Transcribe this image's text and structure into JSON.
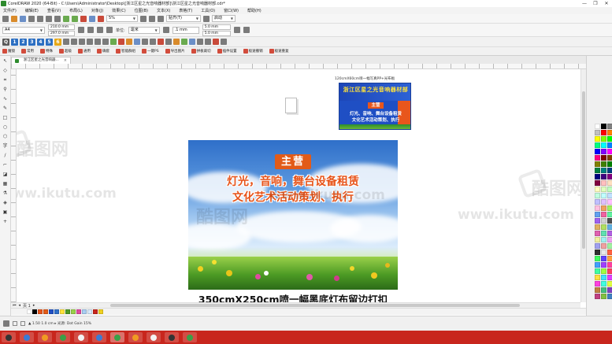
{
  "window": {
    "title": "CorelDRAW 2020 (64-Bit) - C:\\Users\\Administrator\\Desktop\\[浙江区星之光音响器材部]\\浙江区星之光音响器材部.cdr*",
    "controls": [
      "—",
      "❐",
      "✕"
    ]
  },
  "menu": {
    "items": [
      "文件(F)",
      "编辑(E)",
      "查看(V)",
      "布局(L)",
      "对象(J)",
      "效果(C)",
      "位图(B)",
      "文本(X)",
      "表格(T)",
      "工具(O)",
      "窗口(W)",
      "帮助(H)"
    ]
  },
  "toolbar": {
    "zoom": "5%",
    "snap": "贴齐(T)",
    "launch": "启动"
  },
  "propbar": {
    "paper": "A4",
    "width": "210.0 mm",
    "height": "297.0 mm",
    "unit_label": "单位:",
    "unit": "毫米",
    "nudge": ".1 mm",
    "dup_x": "5.0 mm",
    "dup_y": "5.0 mm"
  },
  "plugins_row1": {
    "items": [
      "Q",
      "1",
      "2",
      "3",
      "4",
      "5",
      "6"
    ]
  },
  "plugins_row2": {
    "items": [
      "魔镜",
      "常用",
      "特殊",
      "超级",
      "通用",
      "确套",
      "智能群组",
      "一键PS",
      "导出图片",
      "拼板裁切",
      "插件设置",
      "极速撤销",
      "极速重复"
    ]
  },
  "doc_tab": {
    "label": "浙江区星之光音响器..."
  },
  "canvas": {
    "thumbnail_caption": "120cmX60cm喷一幅写真PP+光布板",
    "thumbnail_title": "浙江区星之光音响器材部",
    "thumbnail_tag": "主营",
    "thumbnail_line1": "灯光、音响、舞台设备租赁",
    "thumbnail_line2": "文化艺术活动策划、执行",
    "banner_tag": "主营",
    "banner_line1": "灯光，音响，舞台设备租赁",
    "banner_line2": "文化艺术活动策划、执行",
    "caption": "350cmX250cm喷一幅黑底灯布留边打扣",
    "watermark_cn": "酷图网",
    "watermark_url": "www.ikutu.com"
  },
  "page_nav": {
    "page": "页 1"
  },
  "status": {
    "text": "▲ 1.50 1.0 cm ▸ 光源: Dot Gain 15%"
  },
  "colors": {
    "taskbar": "#c8261d",
    "banner_text": "#e7541a",
    "banner_tag": "#e25b18",
    "thumb_bg": "#1f4fc4"
  }
}
